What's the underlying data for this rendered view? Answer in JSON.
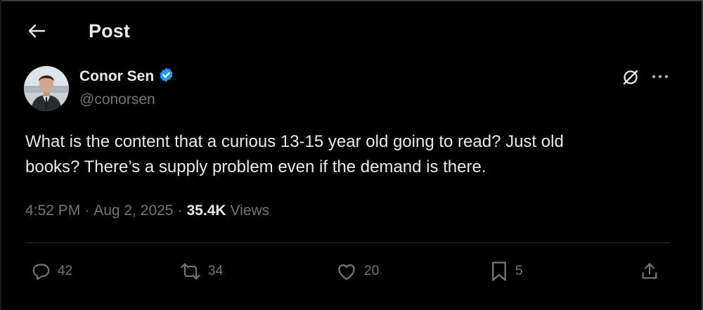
{
  "header": {
    "back_icon": "arrow-left-icon",
    "title": "Post"
  },
  "author": {
    "name": "Conor Sen",
    "handle": "@conorsen",
    "verified_icon": "verified-badge-icon",
    "verified_color": "#1d9bf0"
  },
  "toolbar_icons": {
    "grok": "grok-icon",
    "more": "more-horizontal-icon"
  },
  "tweet": {
    "lines": [
      "What is the content that a curious 13-15 year old going to read? Just old",
      "books? There’s a supply problem even if the demand is there."
    ]
  },
  "meta": {
    "time": "4:52 PM",
    "separator": "·",
    "date": "Aug 2, 2025",
    "views_count": "35.4K",
    "views_label": "Views"
  },
  "actions": {
    "replies": "42",
    "reposts": "34",
    "likes": "20",
    "bookmarks": "5"
  },
  "colors": {
    "background": "#000000",
    "text_primary": "#e7e9ea",
    "text_secondary": "#71767b",
    "divider": "#2f3336",
    "accent": "#1d9bf0"
  }
}
